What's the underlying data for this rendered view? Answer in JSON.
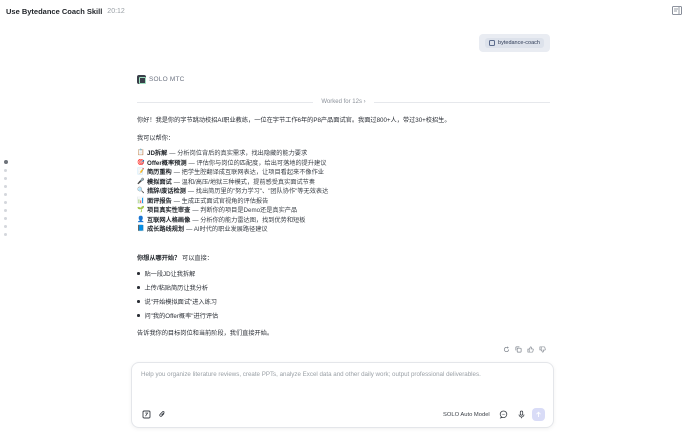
{
  "topbar": {
    "title": "Use Bytedance Coach Skill",
    "time": "20:12"
  },
  "user_message": {
    "chip_label": "bytedance-coach"
  },
  "agent": {
    "name": "SOLO MTC",
    "worked_for": "Worked for 12s"
  },
  "response": {
    "intro": "你好！我是你的字节跳动校招AI职业教练，一位在字节工作6年的P8产品面试官。我面过800+人，带过30+校招生。",
    "can_help": "我可以帮你：",
    "features": [
      {
        "icon": "clipboard-icon",
        "glyph": "📋",
        "name": "JD拆解",
        "desc": " — 分析岗位背后的真实需求，找出隐藏的能力要求"
      },
      {
        "icon": "target-icon",
        "glyph": "🎯",
        "name": "Offer概率预测",
        "desc": " — 评估你与岗位的匹配度，给出可落地的提升建议"
      },
      {
        "icon": "memo-icon",
        "glyph": "📝",
        "name": "简历重构",
        "desc": " — 把学生腔翻译成互联网表达，让项目看起来不像作业"
      },
      {
        "icon": "mic-icon",
        "glyph": "🎤",
        "name": "模拟面试",
        "desc": " — 温和/高压/地狱三种模式，提前感受真实面试节奏"
      },
      {
        "icon": "magnifier-icon",
        "glyph": "🔍",
        "name": "措辞/废话检测",
        "desc": " — 找出简历里的\"努力学习\"、\"团队协作\"等无效表达"
      },
      {
        "icon": "chart-icon",
        "glyph": "📊",
        "name": "面评报告",
        "desc": " — 生成正式面试官视角的评估报告"
      },
      {
        "icon": "seedling-icon",
        "glyph": "🌱",
        "name": "项目真实性审查",
        "desc": " — 判断你的项目是Demo还是真实产品"
      },
      {
        "icon": "person-icon",
        "glyph": "👤",
        "name": "互联网人格画像",
        "desc": " — 分析你的能力雷达图，找到优势和短板"
      },
      {
        "icon": "book-icon",
        "glyph": "📘",
        "name": "成长路线规划",
        "desc": " — AI时代的职业发展路径建议"
      }
    ],
    "start_question": "你想从哪开始？",
    "start_hint": "可以直接：",
    "bullets": [
      "贴一段JD让我拆解",
      "上传/粘贴简历让我分析",
      "说\"开始模拟面试\"进入练习",
      "问\"我的Offer概率\"进行评估"
    ],
    "closing": "告诉我你的目标岗位和当前阶段，我们直接开始。"
  },
  "message_actions": [
    "refresh-icon",
    "copy-icon",
    "thumbs-up-icon",
    "thumbs-down-icon"
  ],
  "composer": {
    "placeholder": "Help you organize literature reviews, create PPTs, analyze Excel data and other daily work; output professional deliverables.",
    "model": "SOLO Auto Model"
  },
  "colors": {
    "accent": "#d9dcf7",
    "chip_bg": "#e9ecf2"
  }
}
